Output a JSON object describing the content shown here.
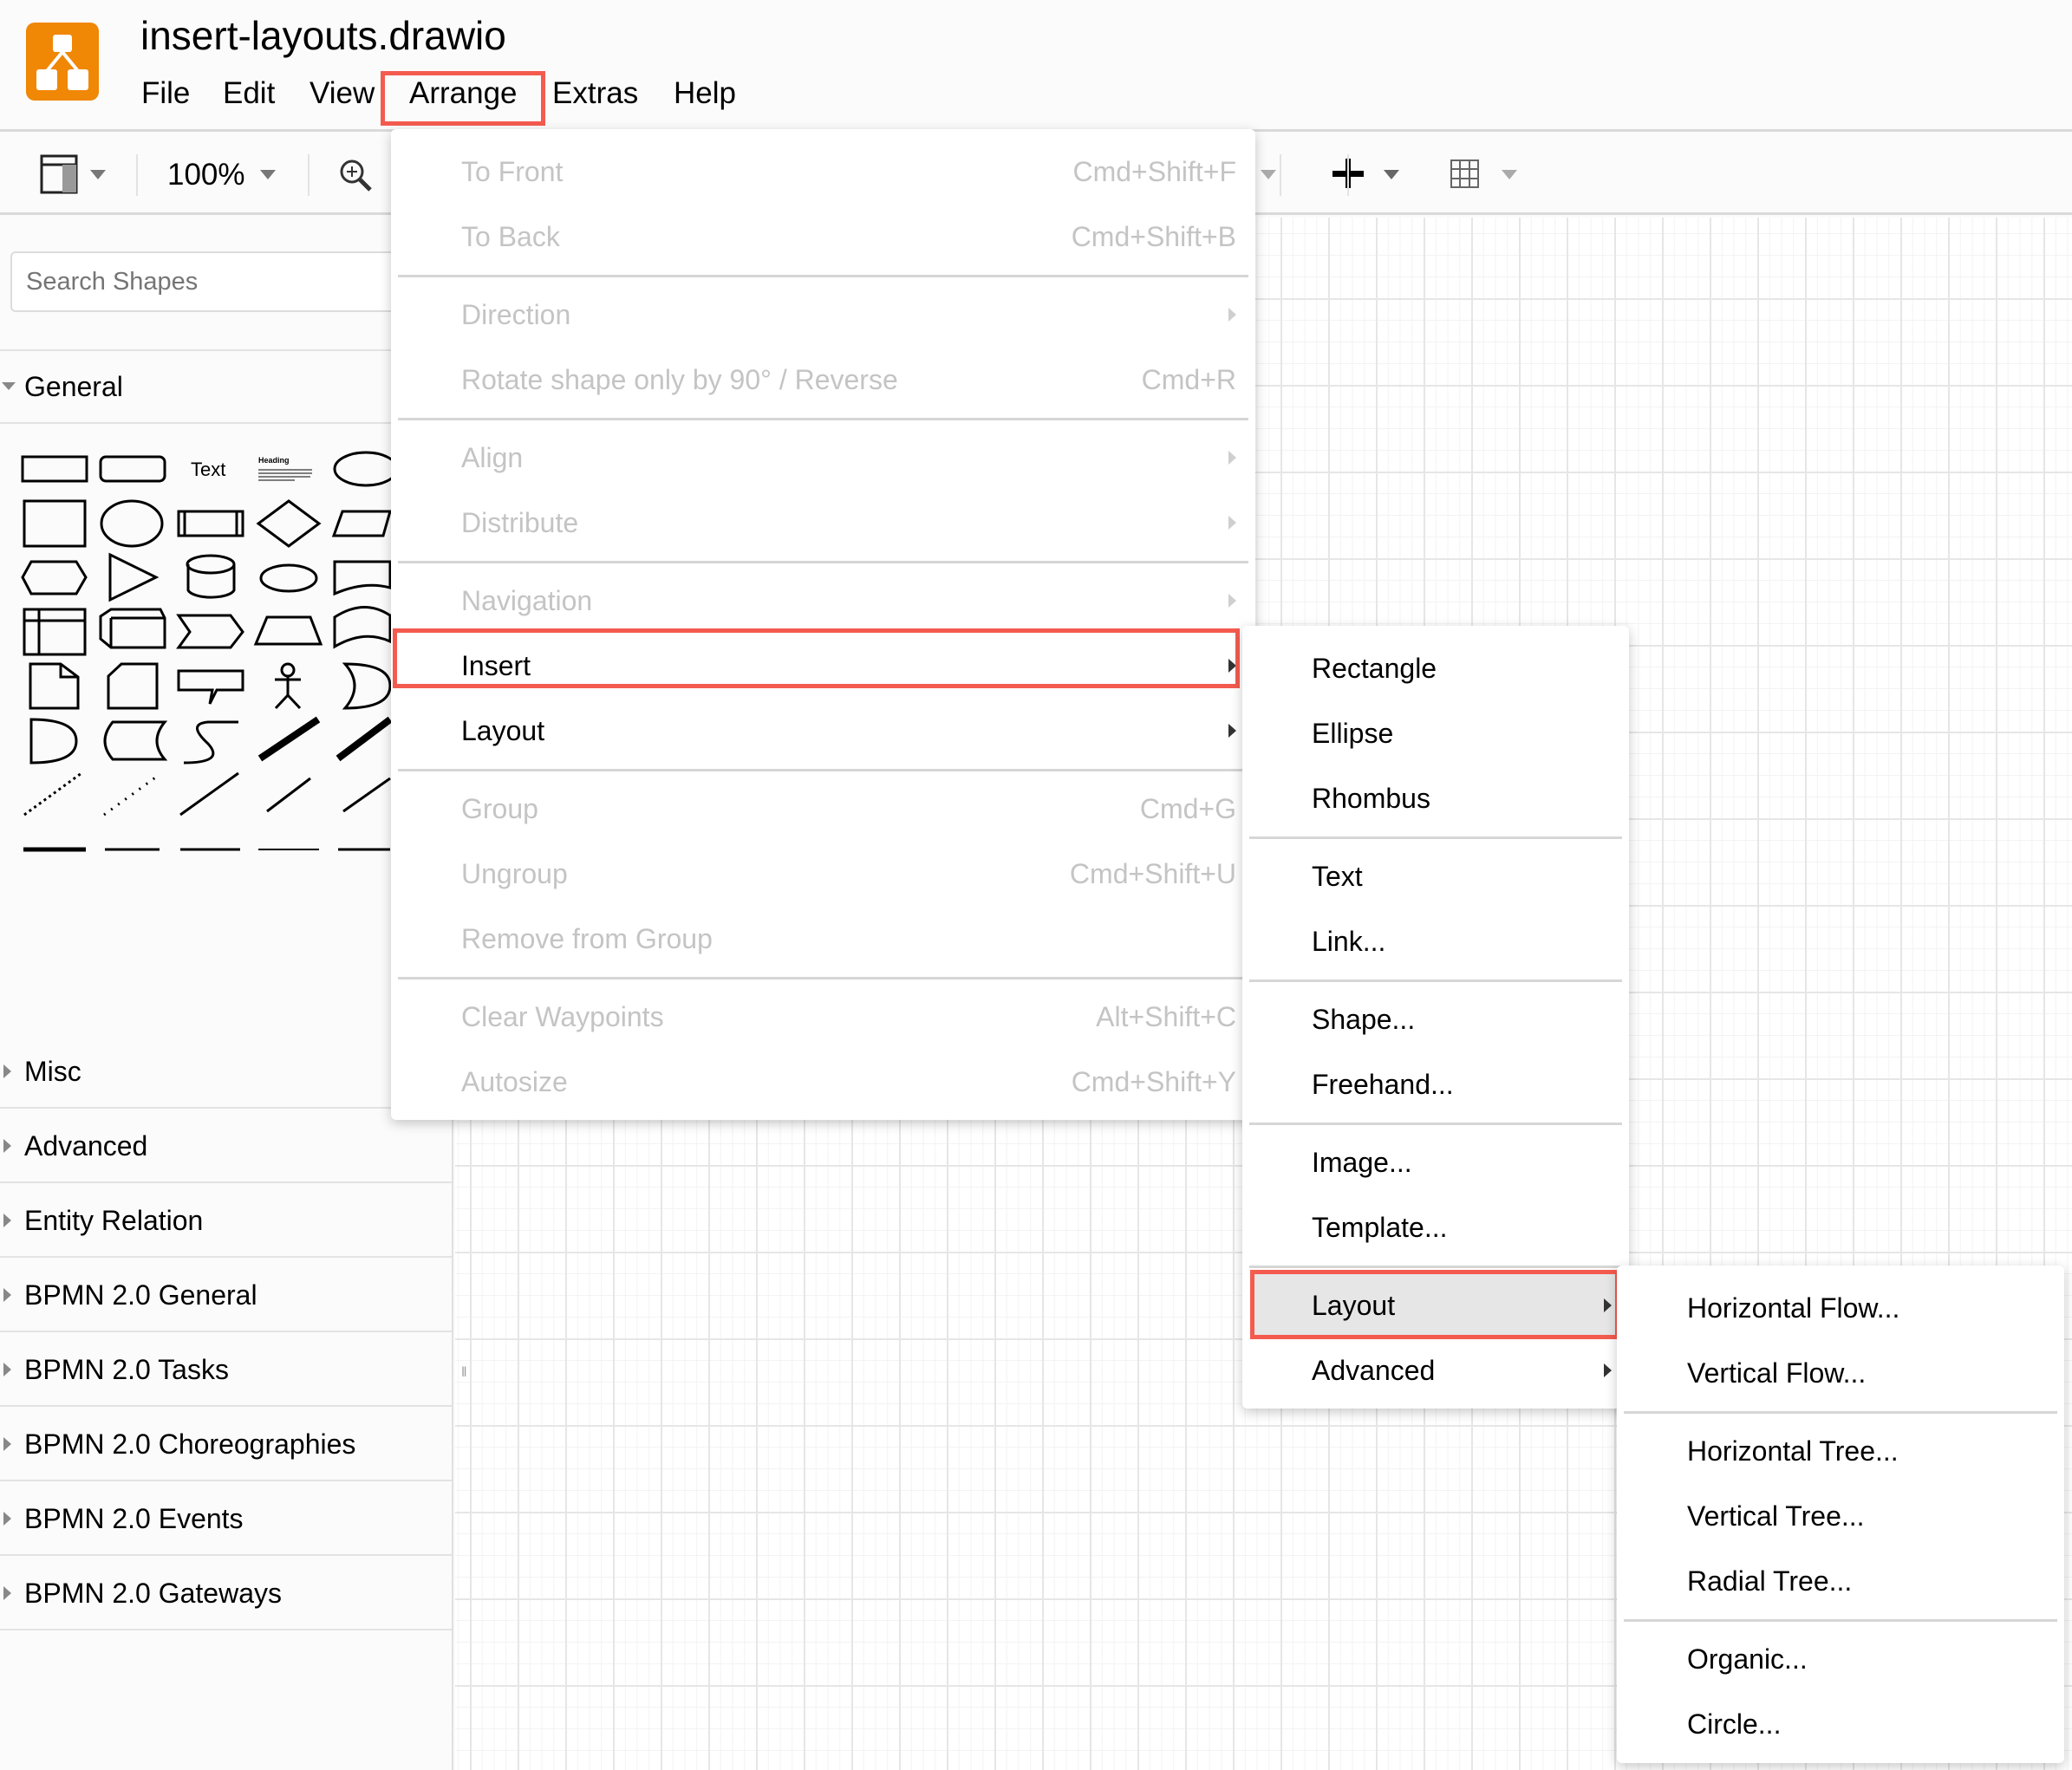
{
  "app": {
    "title": "insert-layouts.drawio",
    "brand_color": "#f08705",
    "highlight_color": "#f45b4f"
  },
  "menubar": [
    {
      "label": "File"
    },
    {
      "label": "Edit"
    },
    {
      "label": "View"
    },
    {
      "label": "Arrange",
      "highlighted": true
    },
    {
      "label": "Extras"
    },
    {
      "label": "Help"
    }
  ],
  "toolbar": {
    "zoom": "100%",
    "icons": [
      "format-panel-icon",
      "zoom-in-icon",
      "insert-plus-icon",
      "table-icon"
    ]
  },
  "sidebar": {
    "search_placeholder": "Search Shapes",
    "open_section": "General",
    "general_text_shape": "Text",
    "general_heading_shape": "Heading",
    "sections": [
      "Misc",
      "Advanced",
      "Entity Relation",
      "BPMN 2.0 General",
      "BPMN 2.0 Tasks",
      "BPMN 2.0 Choreographies",
      "BPMN 2.0 Events",
      "BPMN 2.0 Gateways"
    ]
  },
  "arrange_menu": [
    {
      "label": "To Front",
      "shortcut": "Cmd+Shift+F",
      "disabled": true
    },
    {
      "label": "To Back",
      "shortcut": "Cmd+Shift+B",
      "disabled": true
    },
    {
      "sep": true
    },
    {
      "label": "Direction",
      "submenu": true,
      "disabled": true
    },
    {
      "label": "Rotate shape only by 90° / Reverse",
      "shortcut": "Cmd+R",
      "disabled": true
    },
    {
      "sep": true
    },
    {
      "label": "Align",
      "submenu": true,
      "disabled": true
    },
    {
      "label": "Distribute",
      "submenu": true,
      "disabled": true
    },
    {
      "sep": true
    },
    {
      "label": "Navigation",
      "submenu": true,
      "disabled": true
    },
    {
      "label": "Insert",
      "submenu": true,
      "highlighted": true
    },
    {
      "label": "Layout",
      "submenu": true
    },
    {
      "sep": true
    },
    {
      "label": "Group",
      "shortcut": "Cmd+G",
      "disabled": true
    },
    {
      "label": "Ungroup",
      "shortcut": "Cmd+Shift+U",
      "disabled": true
    },
    {
      "label": "Remove from Group",
      "disabled": true
    },
    {
      "sep": true
    },
    {
      "label": "Clear Waypoints",
      "shortcut": "Alt+Shift+C",
      "disabled": true
    },
    {
      "label": "Autosize",
      "shortcut": "Cmd+Shift+Y",
      "disabled": true
    }
  ],
  "insert_menu": [
    {
      "label": "Rectangle"
    },
    {
      "label": "Ellipse"
    },
    {
      "label": "Rhombus"
    },
    {
      "sep": true
    },
    {
      "label": "Text"
    },
    {
      "label": "Link..."
    },
    {
      "sep": true
    },
    {
      "label": "Shape..."
    },
    {
      "label": "Freehand..."
    },
    {
      "sep": true
    },
    {
      "label": "Image..."
    },
    {
      "label": "Template..."
    },
    {
      "sep": true
    },
    {
      "label": "Layout",
      "submenu": true,
      "highlighted": true
    },
    {
      "label": "Advanced",
      "submenu": true
    }
  ],
  "layout_menu": [
    {
      "label": "Horizontal Flow..."
    },
    {
      "label": "Vertical Flow..."
    },
    {
      "sep": true
    },
    {
      "label": "Horizontal Tree..."
    },
    {
      "label": "Vertical Tree..."
    },
    {
      "label": "Radial Tree..."
    },
    {
      "sep": true
    },
    {
      "label": "Organic..."
    },
    {
      "label": "Circle..."
    }
  ]
}
